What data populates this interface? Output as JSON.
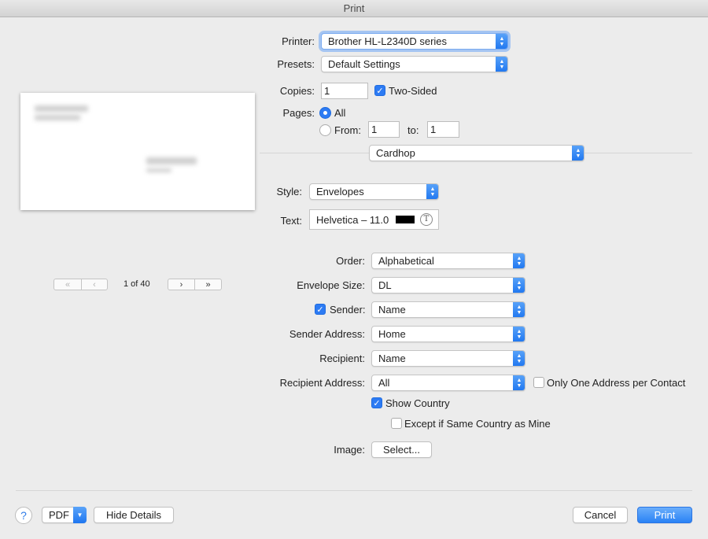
{
  "window": {
    "title": "Print"
  },
  "printer": {
    "label": "Printer:",
    "value": "Brother HL-L2340D series"
  },
  "presets": {
    "label": "Presets:",
    "value": "Default Settings"
  },
  "copies": {
    "label": "Copies:",
    "value": "1",
    "two_sided_label": "Two-Sided",
    "two_sided": true
  },
  "pages": {
    "label": "Pages:",
    "all_label": "All",
    "from_label": "From:",
    "from_value": "1",
    "to_label": "to:",
    "to_value": "1"
  },
  "app_section": {
    "value": "Cardhop"
  },
  "style": {
    "label": "Style:",
    "value": "Envelopes"
  },
  "text": {
    "label": "Text:",
    "value": "Helvetica – 11.0",
    "color": "#000000"
  },
  "preview": {
    "page_indicator": "1 of 40"
  },
  "options": {
    "order": {
      "label": "Order:",
      "value": "Alphabetical"
    },
    "envelope_size": {
      "label": "Envelope Size:",
      "value": "DL"
    },
    "sender": {
      "label": "Sender:",
      "value": "Name",
      "checked": true
    },
    "sender_address": {
      "label": "Sender Address:",
      "value": "Home"
    },
    "recipient": {
      "label": "Recipient:",
      "value": "Name"
    },
    "recipient_address": {
      "label": "Recipient Address:",
      "value": "All"
    },
    "only_one_address_label": "Only One Address per Contact",
    "show_country_label": "Show Country",
    "except_same_country_label": "Except if Same Country as Mine",
    "image": {
      "label": "Image:",
      "button_label": "Select..."
    }
  },
  "footer": {
    "help": "?",
    "pdf_label": "PDF",
    "hide_details_label": "Hide Details",
    "cancel_label": "Cancel",
    "print_label": "Print"
  },
  "colors": {
    "accent": "#2d7bf3",
    "background": "#ececec"
  }
}
